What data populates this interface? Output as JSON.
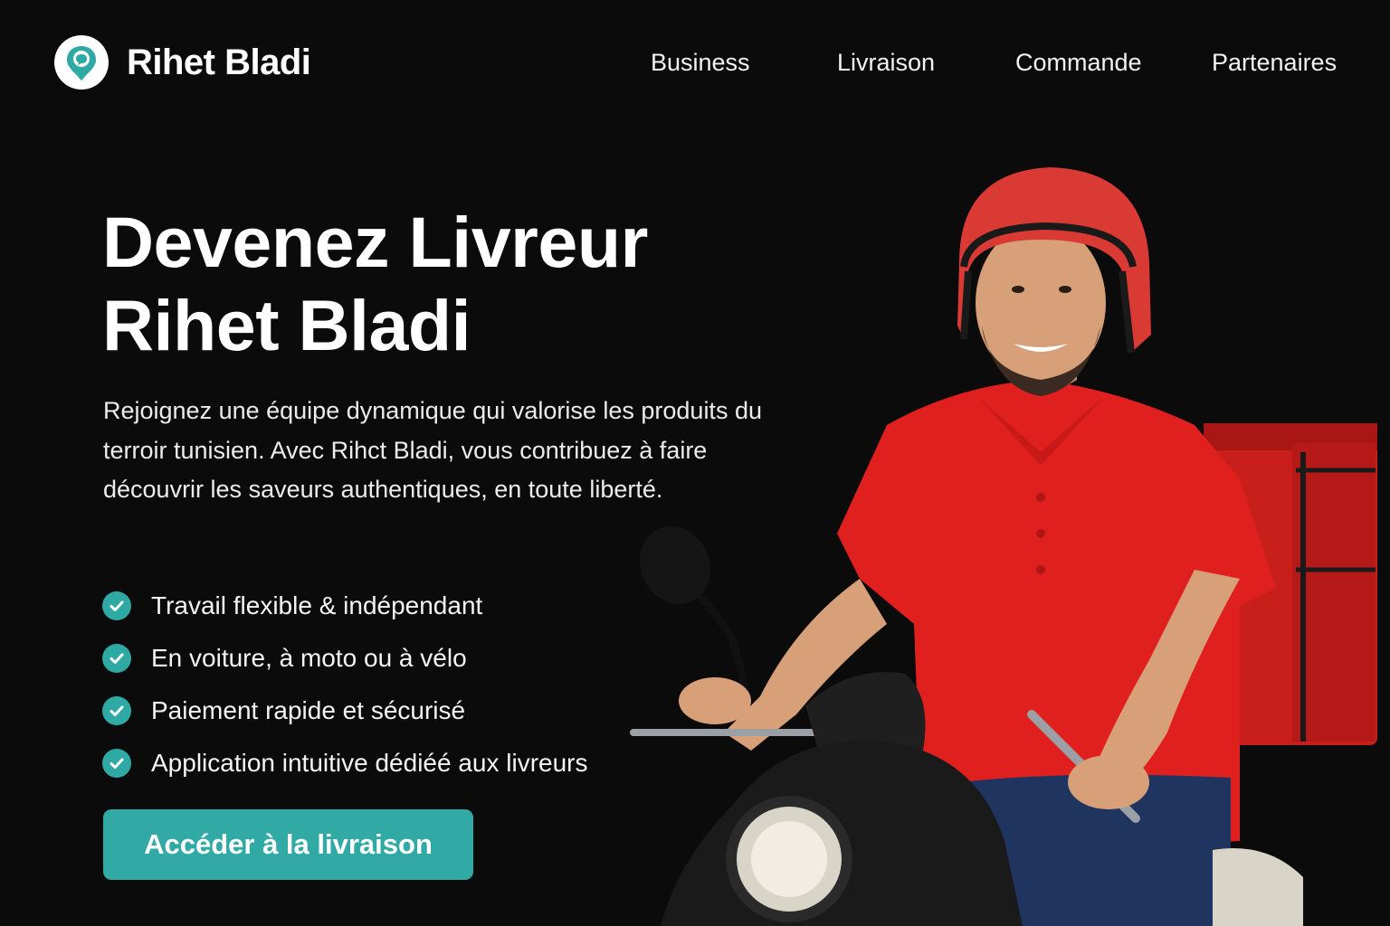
{
  "brand": {
    "name": "Rihet Bladi",
    "accent": "#2ea9a4"
  },
  "nav": {
    "items": [
      "Business",
      "Livraison",
      "Commande",
      "Partenaires"
    ]
  },
  "hero": {
    "title_line1": "Devenez Livreur",
    "title_line2": "Rihet Bladi",
    "description": "Rejoignez une équipe dynamique qui valorise les produits du terroir tunisien. Avec Rihct Bladi, vous contribuez à faire découvrir les saveurs authentiques, en toute liberté.",
    "features": [
      "Travail flexible & indépendant",
      "En voiture, à moto ou à vélo",
      "Paiement rapide et sécurisé",
      "Application intuitive dédiéé aux livreurs"
    ],
    "cta_label": "Accéder à la livraison"
  },
  "icons": {
    "logo": "location-pin-icon",
    "feature": "check-circle-icon"
  },
  "illustration": {
    "subject": "delivery-rider-on-scooter",
    "colors": {
      "shirt": "#e0201f",
      "helmet": "#d93a33",
      "scooter": "#1a1a1b"
    }
  }
}
